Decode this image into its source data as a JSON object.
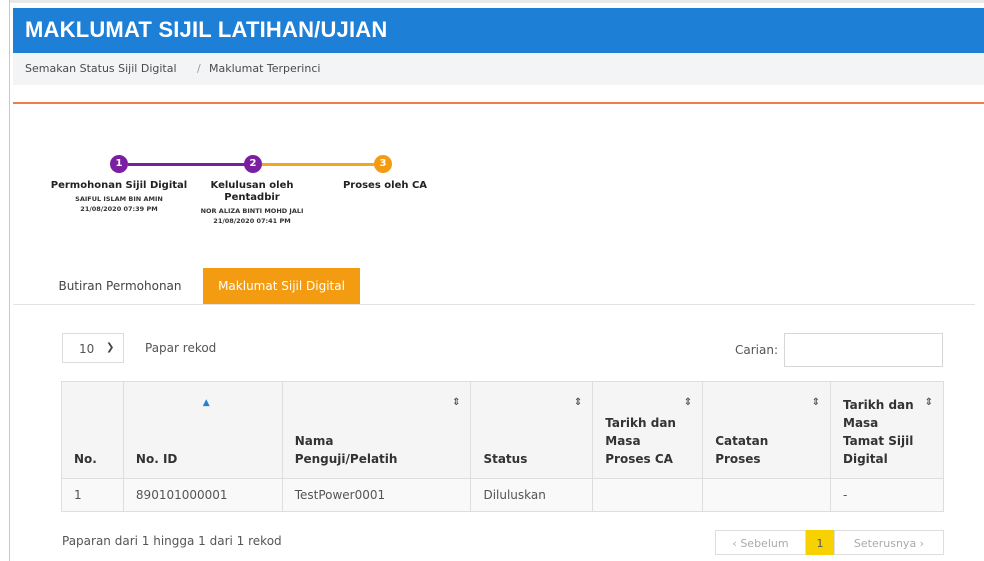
{
  "header": {
    "title": "MAKLUMAT SIJIL LATIHAN/UJIAN"
  },
  "breadcrumb": {
    "items": [
      "Semakan Status Sijil Digital",
      "Maklumat Terperinci"
    ],
    "separator": "/"
  },
  "stepper": {
    "steps": [
      {
        "number": "1",
        "label_line1": "Permohonan Sijil Digital",
        "label_line2": "",
        "person": "SAIFUL ISLAM BIN AMIN",
        "datetime": "21/08/2020 07:39 PM",
        "color": "#7b1fa2"
      },
      {
        "number": "2",
        "label_line1": "Kelulusan oleh",
        "label_line2": "Pentadbir",
        "person": "NOR ALIZA BINTI MOHD JALI",
        "datetime": "21/08/2020 07:41 PM",
        "color": "#7b1fa2"
      },
      {
        "number": "3",
        "label_line1": "Proses oleh CA",
        "label_line2": "",
        "person": "",
        "datetime": "",
        "color": "#f39c12"
      }
    ],
    "line_colors": [
      "#7b1fa2",
      "#f0a820"
    ]
  },
  "tabs": [
    {
      "label": "Butiran Permohonan",
      "active": false
    },
    {
      "label": "Maklumat Sijil Digital",
      "active": true
    }
  ],
  "table_controls": {
    "length_value": "10",
    "length_label": "Papar rekod",
    "search_label": "Carian:",
    "search_value": ""
  },
  "table": {
    "columns": [
      "No.",
      "No. ID",
      "Nama Penguji/Pelatih",
      "Status",
      "Tarikh dan Masa Proses CA",
      "Catatan Proses",
      "Tarikh dan Masa Tamat Sijil Digital"
    ],
    "rows": [
      [
        "1",
        "890101000001",
        "TestPower0001",
        "Diluluskan",
        "",
        "",
        "-"
      ]
    ]
  },
  "footer": {
    "info": "Paparan dari 1 hingga 1 dari 1 rekod",
    "prev_label": "‹ Sebelum",
    "current_page": "1",
    "next_label": "Seterusnya ›"
  },
  "colors": {
    "header": "#1e7fd6",
    "accent_orange": "#f39c12",
    "rule": "#f07c4a",
    "page_active": "#f7d100"
  }
}
